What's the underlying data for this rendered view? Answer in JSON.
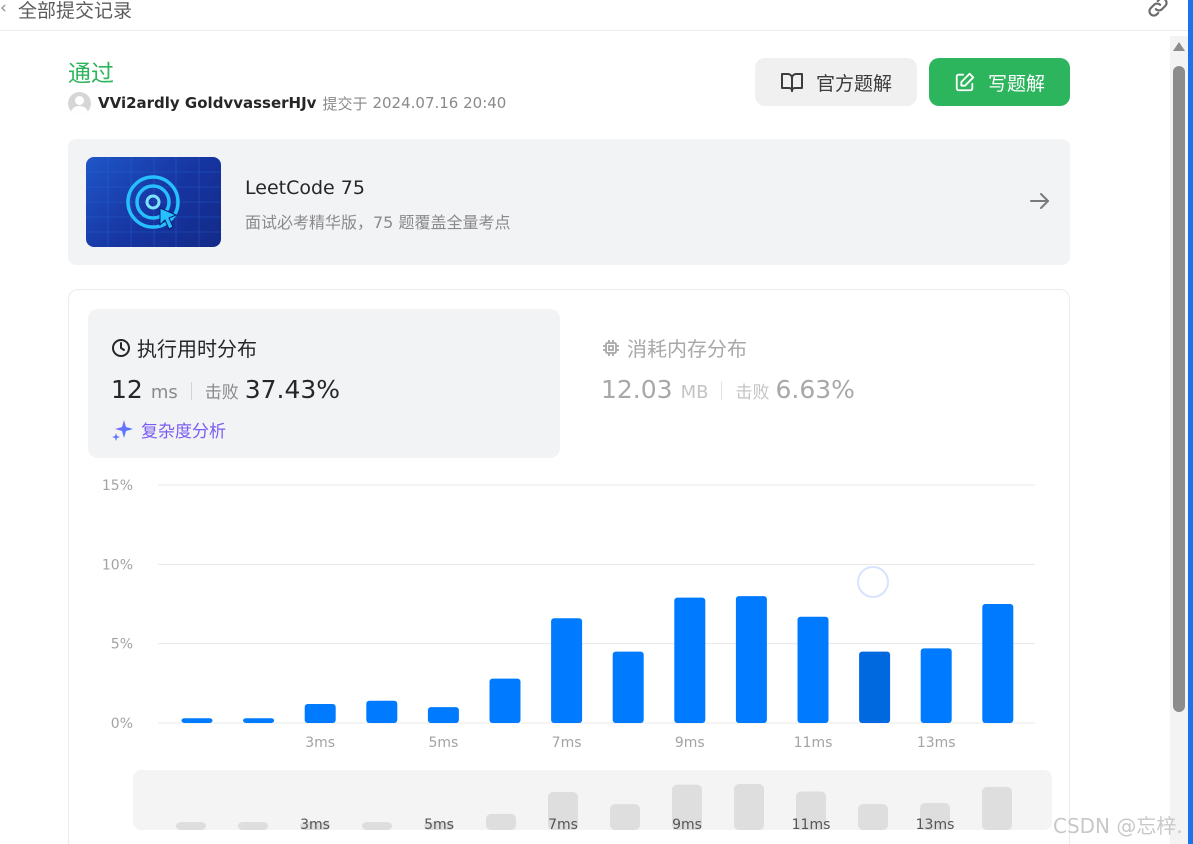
{
  "topbar": {
    "back_glyph": "‹",
    "title": "全部提交记录",
    "link_icon": "link-icon"
  },
  "submission": {
    "status": "通过",
    "user": "VVi2ardly GoldvvasserHJv",
    "submitted_label": "提交于",
    "datetime": "2024.07.16 20:40"
  },
  "buttons": {
    "official": "官方题解",
    "write": "写题解"
  },
  "plan": {
    "title": "LeetCode 75",
    "subtitle": "面试必考精华版，75 题覆盖全量考点"
  },
  "runtime": {
    "title": "执行用时分布",
    "value": "12",
    "unit": "ms",
    "beats_label": "击败",
    "beats_pct": "37.43%",
    "analysis_label": "复杂度分析"
  },
  "memory": {
    "title": "消耗内存分布",
    "value": "12.03",
    "unit": "MB",
    "beats_label": "击败",
    "beats_pct": "6.63%"
  },
  "chart_data": {
    "type": "bar",
    "ylabel_ticks": [
      "0%",
      "5%",
      "10%",
      "15%"
    ],
    "ylim": [
      0,
      15
    ],
    "x_tick_labels": [
      "3ms",
      "5ms",
      "7ms",
      "9ms",
      "11ms",
      "13ms"
    ],
    "categories": [
      "1ms",
      "2ms",
      "3ms",
      "4ms",
      "5ms",
      "6ms",
      "7ms",
      "8ms",
      "9ms",
      "10ms",
      "11ms",
      "12ms",
      "13ms",
      "14ms"
    ],
    "values": [
      0.3,
      0.3,
      1.2,
      1.4,
      1.0,
      2.8,
      6.6,
      4.5,
      7.9,
      8.0,
      6.7,
      4.5,
      4.7,
      7.5
    ],
    "highlight": "12ms",
    "grid": true,
    "colors": {
      "bar": "#007aff",
      "highlight": "#0069e0",
      "grid": "#e8e8e8",
      "tick": "#a3a3a3"
    }
  },
  "minimap": {
    "tick_labels": [
      "3ms",
      "5ms",
      "7ms",
      "9ms",
      "11ms",
      "13ms"
    ],
    "bar_color": "#dedede"
  },
  "watermark": "CSDN @忘梓."
}
